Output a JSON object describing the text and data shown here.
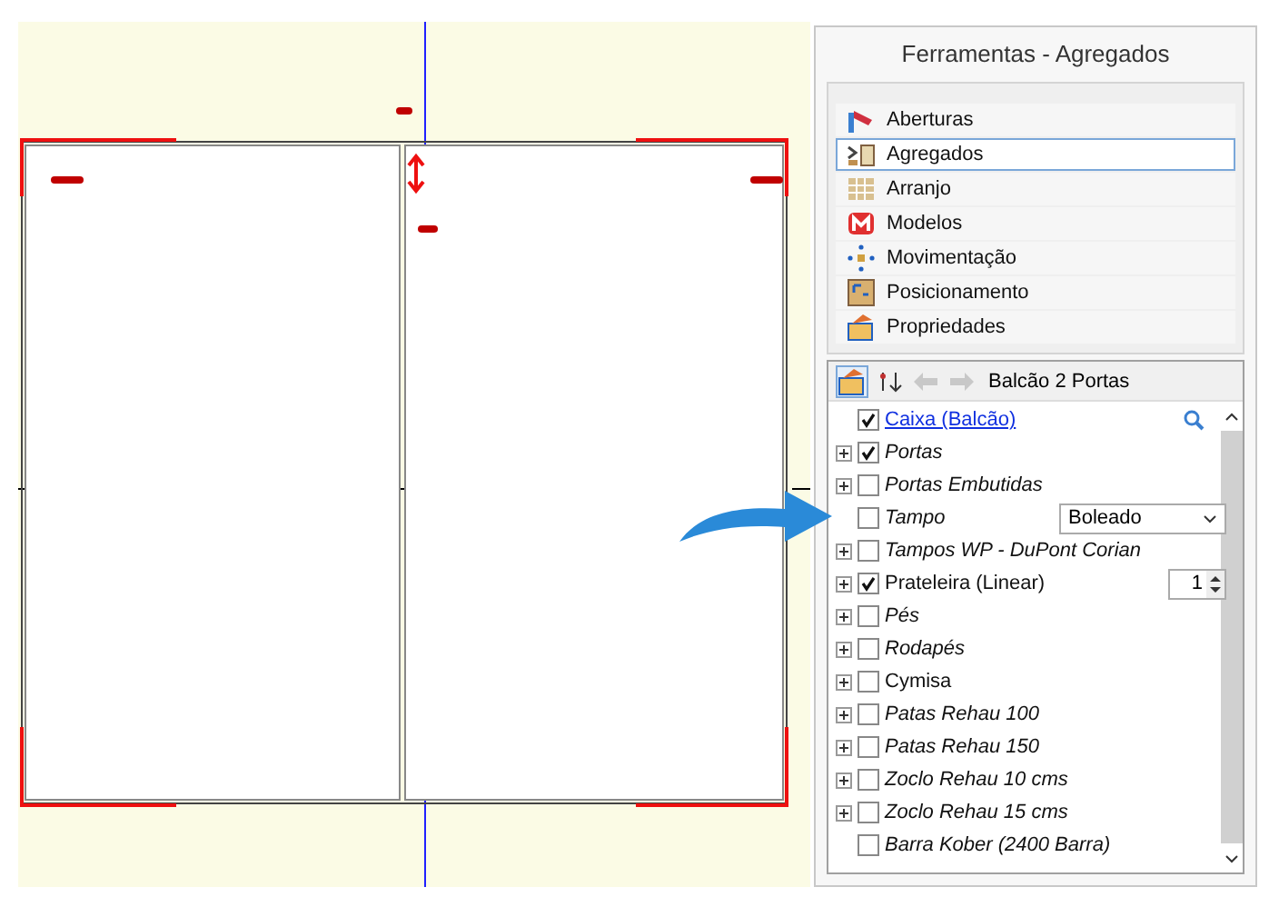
{
  "panel": {
    "title": "Ferramentas - Agregados"
  },
  "tools": [
    {
      "label": "Aberturas",
      "selected": false
    },
    {
      "label": "Agregados",
      "selected": true
    },
    {
      "label": "Arranjo",
      "selected": false
    },
    {
      "label": "Modelos",
      "selected": false
    },
    {
      "label": "Movimentação",
      "selected": false
    },
    {
      "label": "Posicionamento",
      "selected": false
    },
    {
      "label": "Propriedades",
      "selected": false
    }
  ],
  "toolbar": {
    "breadcrumb": "Balcão 2 Portas"
  },
  "tree": [
    {
      "kind": "link",
      "label": "Caixa (Balcão)",
      "checked": true,
      "expandable": false
    },
    {
      "kind": "plain",
      "label": "Portas",
      "checked": true,
      "italic": true,
      "expandable": true
    },
    {
      "kind": "plain",
      "label": "Portas Embutidas",
      "checked": false,
      "italic": true,
      "expandable": true
    },
    {
      "kind": "dropdown",
      "label": "Tampo",
      "checked": false,
      "italic": true,
      "expandable": false,
      "value": "Boleado"
    },
    {
      "kind": "plain",
      "label": "Tampos WP - DuPont Corian",
      "checked": false,
      "italic": true,
      "expandable": true
    },
    {
      "kind": "spinner",
      "label": "Prateleira (Linear)",
      "checked": true,
      "italic": false,
      "expandable": true,
      "value": "1"
    },
    {
      "kind": "plain",
      "label": "Pés",
      "checked": false,
      "italic": true,
      "expandable": true
    },
    {
      "kind": "plain",
      "label": "Rodapés",
      "checked": false,
      "italic": true,
      "expandable": true
    },
    {
      "kind": "plain",
      "label": "Cymisa",
      "checked": false,
      "italic": false,
      "expandable": true
    },
    {
      "kind": "plain",
      "label": "Patas Rehau 100",
      "checked": false,
      "italic": true,
      "expandable": true
    },
    {
      "kind": "plain",
      "label": "Patas Rehau 150",
      "checked": false,
      "italic": true,
      "expandable": true
    },
    {
      "kind": "plain",
      "label": "Zoclo Rehau 10 cms",
      "checked": false,
      "italic": true,
      "expandable": true
    },
    {
      "kind": "plain",
      "label": "Zoclo Rehau 15 cms",
      "checked": false,
      "italic": true,
      "expandable": true
    },
    {
      "kind": "plain",
      "label": "Barra Kober (2400 Barra)",
      "checked": false,
      "italic": true,
      "expandable": false
    }
  ]
}
